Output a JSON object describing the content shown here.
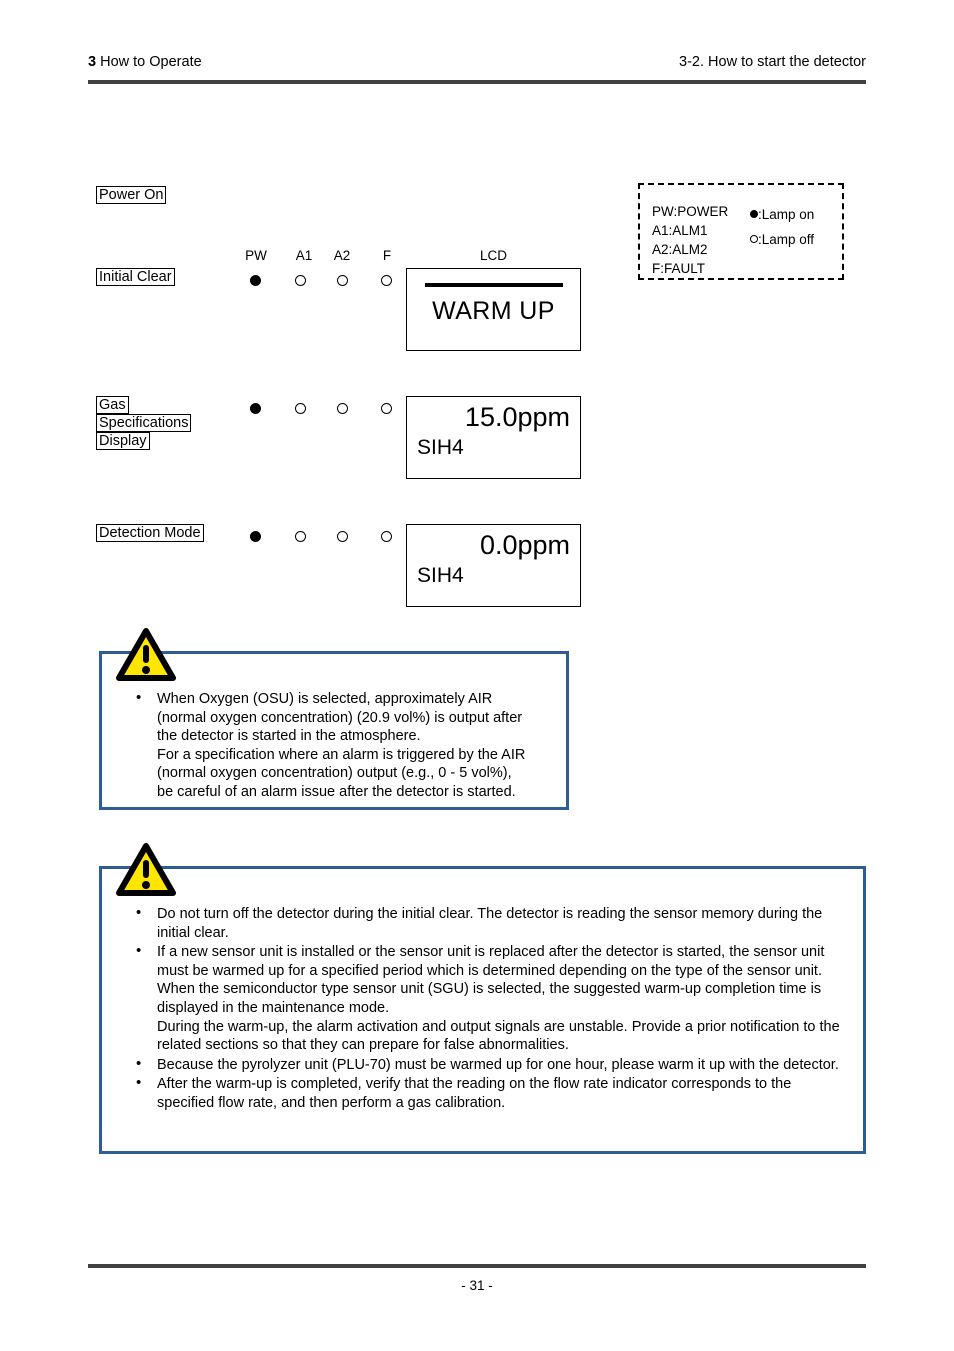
{
  "header": {
    "chapter_num": "3",
    "chapter_title": " How to Operate",
    "section": "3-2. How to start the detector"
  },
  "footer": {
    "page_number": "- 31 -"
  },
  "steps": [
    {
      "name": "power-on",
      "lines": [
        "Power On"
      ]
    },
    {
      "name": "initial-clear",
      "lines": [
        "Initial Clear"
      ]
    },
    {
      "name": "gas-spec",
      "lines": [
        "Gas",
        "Specifications",
        "Display"
      ]
    },
    {
      "name": "detection-mode",
      "lines": [
        "Detection Mode"
      ]
    }
  ],
  "indicator_headers": {
    "pw": "PW",
    "a1": "A1",
    "a2": "A2",
    "f": "F",
    "lcd": "LCD"
  },
  "lamp_rows": [
    {
      "step": "initial-clear",
      "pw": "on",
      "a1": "off",
      "a2": "off",
      "f": "off"
    },
    {
      "step": "gas-spec",
      "pw": "on",
      "a1": "off",
      "a2": "off",
      "f": "off"
    },
    {
      "step": "detection-mode",
      "pw": "on",
      "a1": "off",
      "a2": "off",
      "f": "off"
    }
  ],
  "lcd_panels": {
    "panel1": {
      "bar": true,
      "text": "WARM UP"
    },
    "panel2": {
      "value": "15.0ppm",
      "gas": "SIH4"
    },
    "panel3": {
      "value": "0.0ppm",
      "gas": "SIH4"
    }
  },
  "legend": {
    "abbreviations": [
      "PW:POWER",
      "A1:ALM1",
      "A2:ALM2",
      "F:FAULT"
    ],
    "lamp_on_label": ":Lamp on",
    "lamp_off_label": ":Lamp off"
  },
  "caution_1": {
    "items": [
      {
        "lines": [
          "When Oxygen (OSU) is selected, approximately AIR",
          "(normal oxygen concentration) (20.9 vol%) is output after",
          "the detector is started in the atmosphere.",
          "For a specification where an alarm is triggered by the AIR",
          "(normal oxygen concentration) output (e.g., 0 - 5 vol%),",
          "be careful of an alarm issue after the detector is started."
        ]
      }
    ]
  },
  "caution_2": {
    "items": [
      {
        "lines": [
          "Do not turn off the detector during the initial clear. The detector is reading the sensor memory during the initial clear."
        ]
      },
      {
        "lines": [
          "If a new sensor unit is installed or the sensor unit is replaced after the detector is started, the sensor unit must be warmed up for a specified period which is determined depending on the type of the sensor unit.",
          "When the semiconductor type sensor unit (SGU) is selected, the suggested warm-up completion time is displayed in the maintenance mode.",
          "During the warm-up, the alarm activation and output signals are unstable. Provide a prior notification to the related sections so that they can prepare for false abnormalities."
        ]
      },
      {
        "lines": [
          "Because the pyrolyzer unit (PLU-70) must be warmed up for one hour, please warm it up with the detector."
        ]
      },
      {
        "lines": [
          "After the warm-up is completed, verify that the reading on the flow rate indicator corresponds to the specified flow rate, and then perform a gas calibration."
        ]
      }
    ]
  },
  "colors": {
    "rule": "#414141",
    "caution_border": "#2d5c96",
    "warning_triangle_fill": "#ffe600",
    "warning_triangle_stroke": "#000000"
  }
}
